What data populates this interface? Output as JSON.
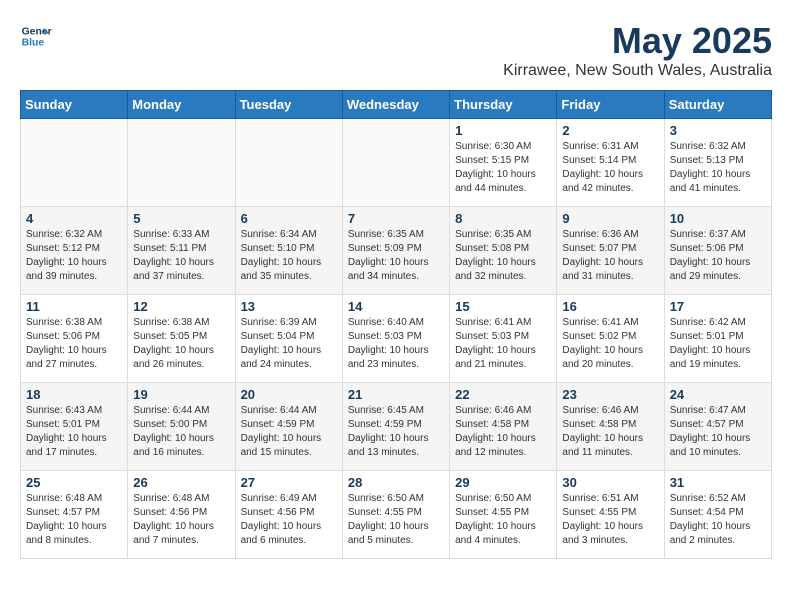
{
  "logo": {
    "line1": "General",
    "line2": "Blue"
  },
  "title": "May 2025",
  "location": "Kirrawee, New South Wales, Australia",
  "days_of_week": [
    "Sunday",
    "Monday",
    "Tuesday",
    "Wednesday",
    "Thursday",
    "Friday",
    "Saturday"
  ],
  "weeks": [
    [
      {
        "day": "",
        "info": ""
      },
      {
        "day": "",
        "info": ""
      },
      {
        "day": "",
        "info": ""
      },
      {
        "day": "",
        "info": ""
      },
      {
        "day": "1",
        "info": "Sunrise: 6:30 AM\nSunset: 5:15 PM\nDaylight: 10 hours\nand 44 minutes."
      },
      {
        "day": "2",
        "info": "Sunrise: 6:31 AM\nSunset: 5:14 PM\nDaylight: 10 hours\nand 42 minutes."
      },
      {
        "day": "3",
        "info": "Sunrise: 6:32 AM\nSunset: 5:13 PM\nDaylight: 10 hours\nand 41 minutes."
      }
    ],
    [
      {
        "day": "4",
        "info": "Sunrise: 6:32 AM\nSunset: 5:12 PM\nDaylight: 10 hours\nand 39 minutes."
      },
      {
        "day": "5",
        "info": "Sunrise: 6:33 AM\nSunset: 5:11 PM\nDaylight: 10 hours\nand 37 minutes."
      },
      {
        "day": "6",
        "info": "Sunrise: 6:34 AM\nSunset: 5:10 PM\nDaylight: 10 hours\nand 35 minutes."
      },
      {
        "day": "7",
        "info": "Sunrise: 6:35 AM\nSunset: 5:09 PM\nDaylight: 10 hours\nand 34 minutes."
      },
      {
        "day": "8",
        "info": "Sunrise: 6:35 AM\nSunset: 5:08 PM\nDaylight: 10 hours\nand 32 minutes."
      },
      {
        "day": "9",
        "info": "Sunrise: 6:36 AM\nSunset: 5:07 PM\nDaylight: 10 hours\nand 31 minutes."
      },
      {
        "day": "10",
        "info": "Sunrise: 6:37 AM\nSunset: 5:06 PM\nDaylight: 10 hours\nand 29 minutes."
      }
    ],
    [
      {
        "day": "11",
        "info": "Sunrise: 6:38 AM\nSunset: 5:06 PM\nDaylight: 10 hours\nand 27 minutes."
      },
      {
        "day": "12",
        "info": "Sunrise: 6:38 AM\nSunset: 5:05 PM\nDaylight: 10 hours\nand 26 minutes."
      },
      {
        "day": "13",
        "info": "Sunrise: 6:39 AM\nSunset: 5:04 PM\nDaylight: 10 hours\nand 24 minutes."
      },
      {
        "day": "14",
        "info": "Sunrise: 6:40 AM\nSunset: 5:03 PM\nDaylight: 10 hours\nand 23 minutes."
      },
      {
        "day": "15",
        "info": "Sunrise: 6:41 AM\nSunset: 5:03 PM\nDaylight: 10 hours\nand 21 minutes."
      },
      {
        "day": "16",
        "info": "Sunrise: 6:41 AM\nSunset: 5:02 PM\nDaylight: 10 hours\nand 20 minutes."
      },
      {
        "day": "17",
        "info": "Sunrise: 6:42 AM\nSunset: 5:01 PM\nDaylight: 10 hours\nand 19 minutes."
      }
    ],
    [
      {
        "day": "18",
        "info": "Sunrise: 6:43 AM\nSunset: 5:01 PM\nDaylight: 10 hours\nand 17 minutes."
      },
      {
        "day": "19",
        "info": "Sunrise: 6:44 AM\nSunset: 5:00 PM\nDaylight: 10 hours\nand 16 minutes."
      },
      {
        "day": "20",
        "info": "Sunrise: 6:44 AM\nSunset: 4:59 PM\nDaylight: 10 hours\nand 15 minutes."
      },
      {
        "day": "21",
        "info": "Sunrise: 6:45 AM\nSunset: 4:59 PM\nDaylight: 10 hours\nand 13 minutes."
      },
      {
        "day": "22",
        "info": "Sunrise: 6:46 AM\nSunset: 4:58 PM\nDaylight: 10 hours\nand 12 minutes."
      },
      {
        "day": "23",
        "info": "Sunrise: 6:46 AM\nSunset: 4:58 PM\nDaylight: 10 hours\nand 11 minutes."
      },
      {
        "day": "24",
        "info": "Sunrise: 6:47 AM\nSunset: 4:57 PM\nDaylight: 10 hours\nand 10 minutes."
      }
    ],
    [
      {
        "day": "25",
        "info": "Sunrise: 6:48 AM\nSunset: 4:57 PM\nDaylight: 10 hours\nand 8 minutes."
      },
      {
        "day": "26",
        "info": "Sunrise: 6:48 AM\nSunset: 4:56 PM\nDaylight: 10 hours\nand 7 minutes."
      },
      {
        "day": "27",
        "info": "Sunrise: 6:49 AM\nSunset: 4:56 PM\nDaylight: 10 hours\nand 6 minutes."
      },
      {
        "day": "28",
        "info": "Sunrise: 6:50 AM\nSunset: 4:55 PM\nDaylight: 10 hours\nand 5 minutes."
      },
      {
        "day": "29",
        "info": "Sunrise: 6:50 AM\nSunset: 4:55 PM\nDaylight: 10 hours\nand 4 minutes."
      },
      {
        "day": "30",
        "info": "Sunrise: 6:51 AM\nSunset: 4:55 PM\nDaylight: 10 hours\nand 3 minutes."
      },
      {
        "day": "31",
        "info": "Sunrise: 6:52 AM\nSunset: 4:54 PM\nDaylight: 10 hours\nand 2 minutes."
      }
    ]
  ]
}
